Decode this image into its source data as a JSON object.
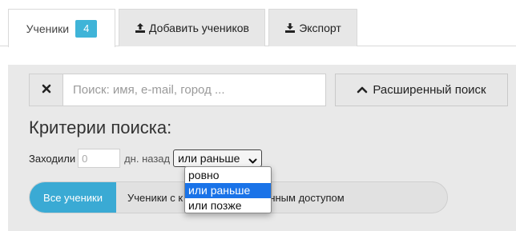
{
  "tabs": [
    {
      "label": "Ученики",
      "badge": "4",
      "icon": null
    },
    {
      "label": "Добавить учеников",
      "icon": "upload-icon"
    },
    {
      "label": "Экспорт",
      "icon": "download-icon"
    }
  ],
  "search": {
    "placeholder": "Поиск: имя, e-mail, город ...",
    "value": "",
    "clear_icon": "close-icon",
    "advanced_label": "Расширенный поиск",
    "advanced_icon": "chevron-up-icon"
  },
  "criteria": {
    "title": "Критерии поиска:",
    "visited_label": "Заходили",
    "days_placeholder": "0",
    "days_value": "",
    "ago_label": "дн. назад",
    "selected_option": "или раньше",
    "options": [
      "ровно",
      "или раньше",
      "или позже"
    ]
  },
  "filters": [
    {
      "label": "Все ученики",
      "active": true
    },
    {
      "label": "Ученики с к",
      "active": false
    },
    {
      "label": "ники с выключенным доступом",
      "active": false
    }
  ],
  "colors": {
    "accent": "#3aaad4",
    "badge": "#3fb4d8",
    "selected_option": "#1a73e8",
    "panel_bg": "#e9e9e9"
  }
}
